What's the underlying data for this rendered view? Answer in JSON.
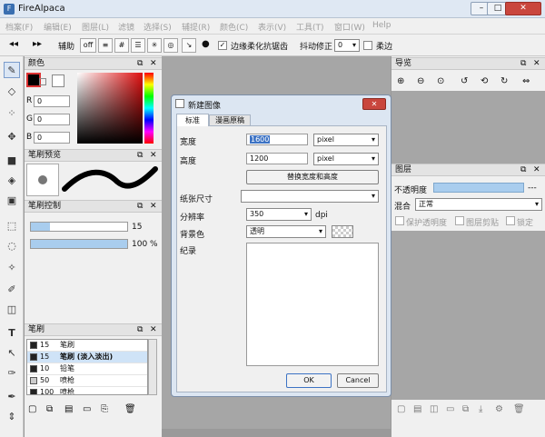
{
  "window": {
    "title": "FireAlpaca",
    "minimize": "–",
    "maximize": "□",
    "close": "✕"
  },
  "menu": [
    "档案(F)",
    "编辑(E)",
    "图层(L)",
    "滤镜",
    "选择(S)",
    "辅提(R)",
    "颜色(C)",
    "表示(V)",
    "工具(T)",
    "窗口(W)",
    "Help"
  ],
  "toolbar": {
    "assist_label": "辅助",
    "off_label": "off",
    "antialias_label": "边缘柔化抗锯齿",
    "stabilizer_label": "抖动修正",
    "stabilizer_value": "0",
    "soft_label": "柔边"
  },
  "color_panel": {
    "title": "颜色",
    "r_label": "R",
    "r_value": "0",
    "g_label": "G",
    "g_value": "0",
    "b_label": "B",
    "b_value": "0",
    "colors": {
      "primary": "#000000",
      "secondary": "#ffffff"
    }
  },
  "brush_preview": {
    "title": "笔刷预览"
  },
  "brush_control": {
    "title": "笔刷控制",
    "size_value": "15",
    "opacity_value": "100 %",
    "size_fraction": 0.2,
    "opacity_fraction": 1.0
  },
  "brush_list": {
    "title": "笔刷",
    "items": [
      {
        "size": "15",
        "name": "笔刷",
        "color": "#222222"
      },
      {
        "size": "15",
        "name": "笔刷 (淡入淡出)",
        "color": "#222222"
      },
      {
        "size": "10",
        "name": "铅笔",
        "color": "#222222"
      },
      {
        "size": "50",
        "name": "喷枪",
        "color": "#cccccc"
      },
      {
        "size": "100",
        "name": "喷枪",
        "color": "#222222"
      }
    ]
  },
  "navigator": {
    "title": "导览"
  },
  "layers": {
    "title": "图层",
    "opacity_label": "不透明度",
    "opacity_value": "---",
    "blend_label": "混合",
    "blend_value": "正常",
    "protect_label": "保护透明度",
    "clip_label": "图层剪贴",
    "lock_label": "锁定"
  },
  "dialog": {
    "title": "新建图像",
    "tabs": [
      "标准",
      "漫画原稿"
    ],
    "width_label": "宽度",
    "width_value": "1600",
    "width_unit": "pixel",
    "height_label": "高度",
    "height_value": "1200",
    "height_unit": "pixel",
    "swap_button": "替换宽度和高度",
    "paper_label": "纸张尺寸",
    "paper_value": "",
    "dpi_label": "分辨率",
    "dpi_value": "350",
    "dpi_unit": "dpi",
    "bg_label": "背景色",
    "bg_value": "透明",
    "record_label": "纪录",
    "ok": "OK",
    "cancel": "Cancel"
  }
}
